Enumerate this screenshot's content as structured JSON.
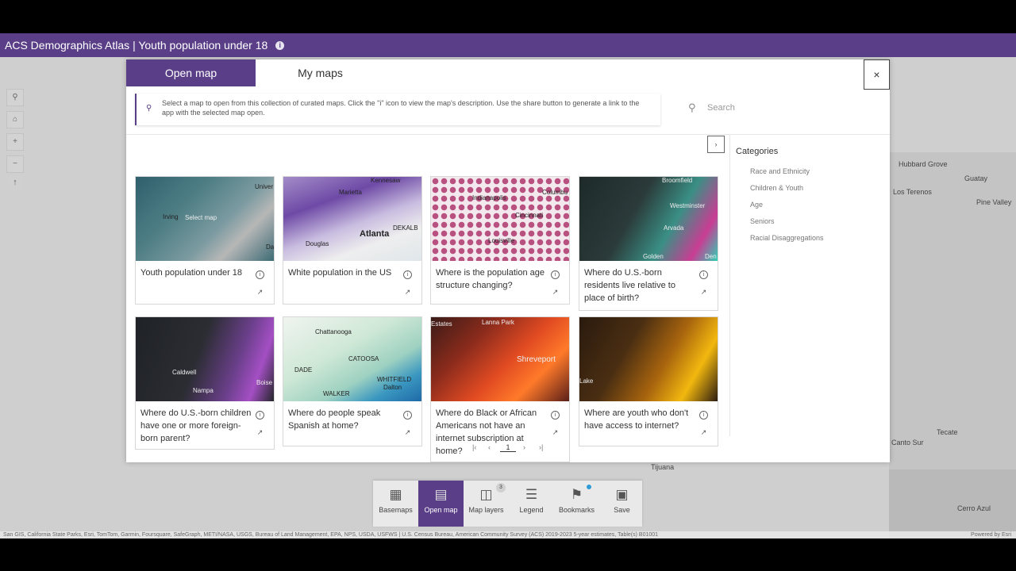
{
  "app": {
    "title": "ACS Demographics Atlas | Youth population under 18"
  },
  "map": {
    "labels": [
      "Hubbard Grove",
      "Guatay",
      "Pine Valley",
      "Los Terenos",
      "Tecate",
      "Cerro Azul",
      "Tijuana",
      "Canto Sur"
    ],
    "attribution": "San GIS, California State Parks, Esri, TomTom, Garmin, Foursquare, SafeGraph, METI/NASA, USGS, Bureau of Land Management, EPA, NPS, USDA, USFWS | U.S. Census Bureau, American Community Survey (ACS) 2019-2023 5-year estimates, Table(s) B01001",
    "powered_by": "Powered by Esri"
  },
  "modal": {
    "tabs": [
      {
        "label": "Open map"
      },
      {
        "label": "My maps"
      }
    ],
    "close_label": "×",
    "notice": "Select a map to open from this collection of curated maps. Click the \"i\" icon to view the map's description. Use the share button to generate a link to the app with the selected map open.",
    "search_placeholder": "Search",
    "select_hint": "Select map",
    "cards": [
      {
        "title": "Youth population under 18",
        "labels": [
          "Irving",
          "Univer",
          "Da"
        ]
      },
      {
        "title": "White population in the US",
        "labels": [
          "Kennesaw",
          "Marietta",
          "Atlanta",
          "Douglas",
          "DEKALB"
        ]
      },
      {
        "title": "Where is the population age structure changing?",
        "labels": [
          "Indianapolis",
          "Columbu",
          "Cincinnati",
          "Louisville"
        ]
      },
      {
        "title": "Where do U.S.-born residents live relative to place of birth?",
        "labels": [
          "Broomfield",
          "Westminster",
          "Arvada",
          "Golden",
          "Den"
        ]
      },
      {
        "title": "Where do U.S.-born children have one or more foreign-born parent?",
        "labels": [
          "Caldwell",
          "Nampa",
          "Boise"
        ]
      },
      {
        "title": "Where do people speak Spanish at home?",
        "labels": [
          "Chattanooga",
          "CATOOSA",
          "WHITFIELD",
          "DADE",
          "WALKER",
          "Dalton"
        ]
      },
      {
        "title": "Where do Black or African Americans not have an internet subscription at home?",
        "labels": [
          "Estates",
          "Lanna Park",
          "Shreveport"
        ]
      },
      {
        "title": "Where are youth who don't have access to internet?",
        "labels": [
          "Lake"
        ]
      }
    ],
    "categories_title": "Categories",
    "categories": [
      "Race and Ethnicity",
      "Children & Youth",
      "Age",
      "Seniors",
      "Racial Disaggregations"
    ],
    "pager": {
      "current": "1"
    }
  },
  "toolbar": {
    "items": [
      {
        "label": "Basemaps"
      },
      {
        "label": "Open map"
      },
      {
        "label": "Map layers",
        "badge": "3"
      },
      {
        "label": "Legend"
      },
      {
        "label": "Bookmarks"
      },
      {
        "label": "Save"
      }
    ]
  }
}
